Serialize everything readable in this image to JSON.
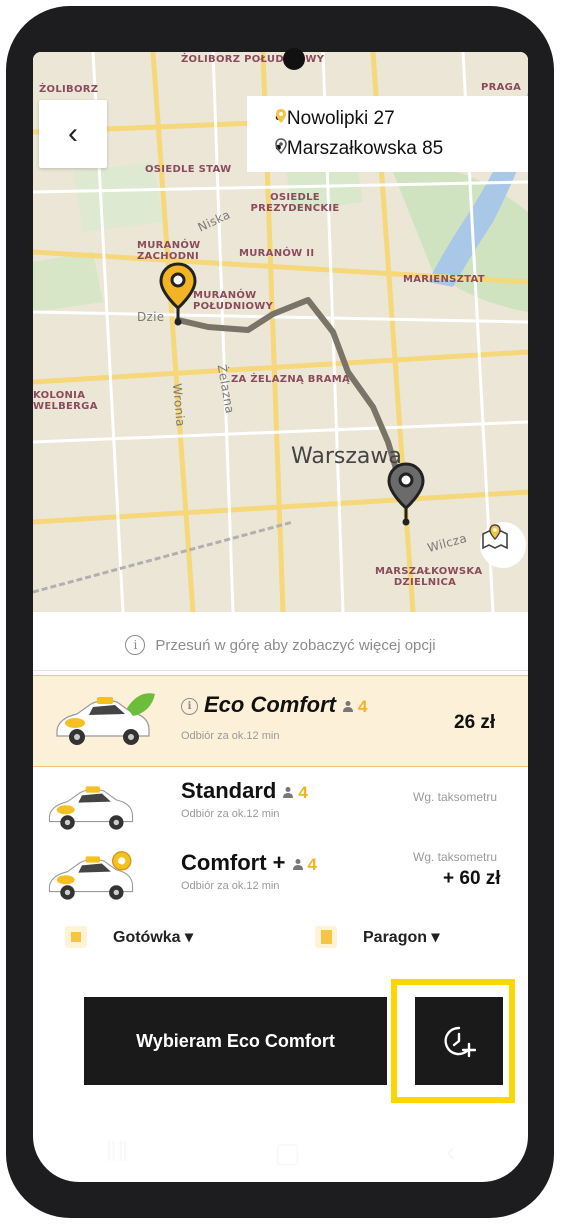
{
  "route": {
    "pickup": "• Nowolipki 27",
    "destination": "• Marszałkowska 85"
  },
  "map": {
    "districts": [
      "ŻOLIBORZ POŁUDNIOWY",
      "ŻOLIBORZ",
      "PRAGA",
      "OSIEDLE STAW",
      "OSIEDLE PREZYDENCKIE",
      "MURANÓW ZACHODNI",
      "MURANÓW II",
      "MARIENSZTAT",
      "MURANÓW POŁUDNIOWY",
      "ZA ŻELAZNĄ BRAMĄ",
      "KOLONIA WELBERGA",
      "MARSZAŁKOWSKA DZIELNICA"
    ],
    "city": "Warszawa",
    "streets": [
      "Niska",
      "Żelazna",
      "Wronia",
      "Wilcza",
      "Dzie"
    ],
    "colors": {
      "pickup_pin": "#f2b424",
      "destination_pin": "#6b6b6b",
      "route_line": "#7a7468"
    }
  },
  "hint": {
    "text": "Przesuń w górę aby zobaczyć więcej opcji",
    "icon": "info-icon"
  },
  "options": [
    {
      "title": "Eco Comfort",
      "seats": "4",
      "eta": "Odbiór za ok.12 min",
      "price": "26 zł",
      "meter": "",
      "selected": true
    },
    {
      "title": "Standard",
      "seats": "4",
      "eta": "Odbiór za ok.12 min",
      "price": "",
      "meter": "Wg. taksometru",
      "selected": false
    },
    {
      "title": "Comfort +",
      "seats": "4",
      "eta": "Odbiór za ok.12 min",
      "price": "+ 60 zł",
      "meter": "Wg. taksometru",
      "selected": false
    }
  ],
  "payment": {
    "method": "Gotówka ▾",
    "receipt": "Paragon ▾"
  },
  "actions": {
    "confirm_label": "Wybieram Eco Comfort",
    "schedule_icon": "clock-plus-icon"
  },
  "colors": {
    "accent": "#f2b424",
    "selected_bg": "#fdf0d8",
    "button_bg": "#1a1a1a",
    "highlight": "#ffd600"
  }
}
